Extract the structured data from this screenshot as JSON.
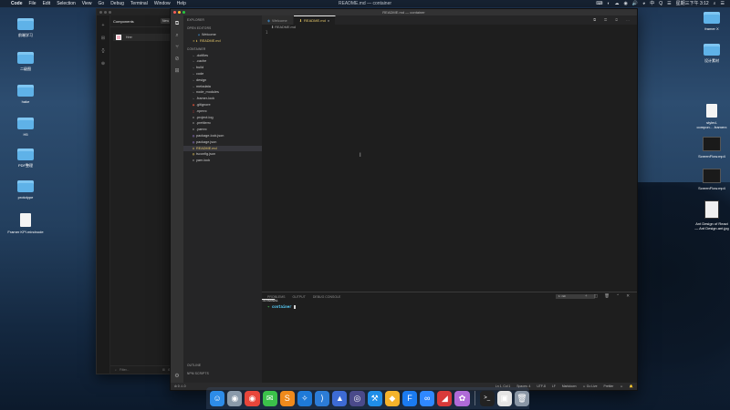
{
  "menubar": {
    "apple": "",
    "items": [
      "Code",
      "File",
      "Edit",
      "Selection",
      "View",
      "Go",
      "Debug",
      "Terminal",
      "Window",
      "Help"
    ],
    "window_title": "README.md — container",
    "right": [
      "⌨",
      "◐",
      "☁",
      "◉",
      "🔊",
      "◕",
      "中",
      "Q",
      "☰",
      "星期三下午 3:12",
      "⌕",
      "☰"
    ]
  },
  "desktop_left": [
    {
      "label": "前端学习",
      "icon": "folder"
    },
    {
      "label": "二级图",
      "icon": "folder"
    },
    {
      "label": "hake",
      "icon": "folder"
    },
    {
      "label": "H5",
      "icon": "folder"
    },
    {
      "label": "PDF整理",
      "icon": "folder"
    },
    {
      "label": "prototype",
      "icon": "folder"
    },
    {
      "label": "Framer KPI.mindnode",
      "icon": "doc"
    }
  ],
  "desktop_right": [
    {
      "label": "framer X",
      "icon": "folder"
    },
    {
      "label": "设计素材",
      "icon": "folder"
    },
    {
      "label": "styled-compon….framerx",
      "icon": "doc"
    },
    {
      "label": "ScreenFlow.mp4",
      "icon": "video"
    },
    {
      "label": "ScreenFlow.mp4",
      "icon": "video"
    },
    {
      "label": "Ant Design of React — Ant Design.ant.jpg",
      "icon": "video2"
    }
  ],
  "framer": {
    "rail_icons": [
      "+",
      "⊞",
      "{}",
      "⊕"
    ],
    "panel_title": "Components",
    "new_button": "New",
    "component_name": "Hrer",
    "filter_placeholder": "Filter...",
    "footer_icons": [
      "⌕",
      "⊞",
      "⚙"
    ]
  },
  "vscode": {
    "window_title": "README.md — container",
    "activity_icons": [
      "⧉",
      "⌕",
      "⑂",
      "⊘",
      "⊞"
    ],
    "activity_bottom": "⚙",
    "sidebar": {
      "explorer_label": "EXPLORER",
      "open_editors_label": "OPEN EDITORS",
      "open_editors": [
        {
          "icon": "◈",
          "name": "Welcome",
          "selected": false
        },
        {
          "icon": "✕ ⬇",
          "name": "README.md",
          "selected": false
        }
      ],
      "project_label": "CONTAINER",
      "files": [
        {
          "icon": "›",
          "name": ".dotfiles"
        },
        {
          "icon": "›",
          "name": ".cache"
        },
        {
          "icon": "›",
          "name": "build"
        },
        {
          "icon": "›",
          "name": "code"
        },
        {
          "icon": "›",
          "name": "design"
        },
        {
          "icon": "›",
          "name": "metadata"
        },
        {
          "icon": "›",
          "name": "node_modules"
        },
        {
          "icon": "›",
          "name": ".framer-lock"
        },
        {
          "icon": "◉",
          "name": ".gitignore"
        },
        {
          "icon": "◻",
          "name": ".npmrc"
        },
        {
          "icon": "≡",
          "name": ".project.log"
        },
        {
          "icon": "≡",
          "name": ".prettierrc"
        },
        {
          "icon": "≡",
          "name": ".yarnrc"
        },
        {
          "icon": "◍",
          "name": "package-lock.json"
        },
        {
          "icon": "◍",
          "name": "package.json"
        },
        {
          "icon": "⬇",
          "name": "README.md",
          "selected": true
        },
        {
          "icon": "◍",
          "name": "tsconfig.json"
        },
        {
          "icon": "≡",
          "name": "yarn.lock"
        }
      ],
      "outline_label": "OUTLINE",
      "npm_label": "NPM SCRIPTS"
    },
    "tabs": [
      {
        "icon": "◈",
        "label": "Welcome",
        "active": false
      },
      {
        "icon": "⬇",
        "label": "README.md",
        "close": "×",
        "active": true
      }
    ],
    "tab_actions": "⧉ ◫ ⊡ ⋯",
    "breadcrumb": "⬇ README.md",
    "line_number": "1",
    "cursor_glyph": "I",
    "terminal": {
      "tabs": [
        "PROBLEMS",
        "OUTPUT",
        "DEBUG CONSOLE",
        "TERMINAL"
      ],
      "active_tab": "TERMINAL",
      "shell_select": "1: zsh",
      "icons": "+ ◫ 🗑 ⌃ ✕",
      "prompt_arrow": "➜",
      "prompt_dir": "container"
    },
    "status_left": "⊘ 0  ⚠ 0",
    "status_right": [
      "Ln 1, Col 1",
      "Spaces: 4",
      "UTF-8",
      "LF",
      "Markdown",
      "☺ Go Live",
      "Prettier",
      "☺",
      "🔔"
    ]
  },
  "dock": {
    "icons": [
      {
        "name": "finder",
        "glyph": "☺",
        "color": "#2d8ce8"
      },
      {
        "name": "launchpad",
        "glyph": "◉",
        "color": "#8a9aaa"
      },
      {
        "name": "chrome",
        "glyph": "◉",
        "color": "#e8463a"
      },
      {
        "name": "wechat",
        "glyph": "✉",
        "color": "#3bc14a"
      },
      {
        "name": "sublime",
        "glyph": "S",
        "color": "#ef8a1c"
      },
      {
        "name": "safari",
        "glyph": "✧",
        "color": "#1e7ad8"
      },
      {
        "name": "vscode",
        "glyph": "⟩",
        "color": "#2c7cd6"
      },
      {
        "name": "affinity",
        "glyph": "▲",
        "color": "#3d6bd4"
      },
      {
        "name": "motion",
        "glyph": "◎",
        "color": "#4a4a8a"
      },
      {
        "name": "xcode",
        "glyph": "⚒",
        "color": "#1f8ee8"
      },
      {
        "name": "sketch",
        "glyph": "◆",
        "color": "#f5b32b"
      },
      {
        "name": "framer",
        "glyph": "F",
        "color": "#1b7bf0"
      },
      {
        "name": "baidu",
        "glyph": "∞",
        "color": "#2f88ff"
      },
      {
        "name": "pages",
        "glyph": "◢",
        "color": "#d83a3a"
      },
      {
        "name": "game",
        "glyph": "✿",
        "color": "#b06ad8"
      },
      {
        "name": "terminal",
        "glyph": ">_",
        "color": "#222222"
      },
      {
        "name": "preview",
        "glyph": "▣",
        "color": "#e4e4e4"
      },
      {
        "name": "trash",
        "glyph": "🗑",
        "color": "#8a97a6"
      }
    ]
  }
}
